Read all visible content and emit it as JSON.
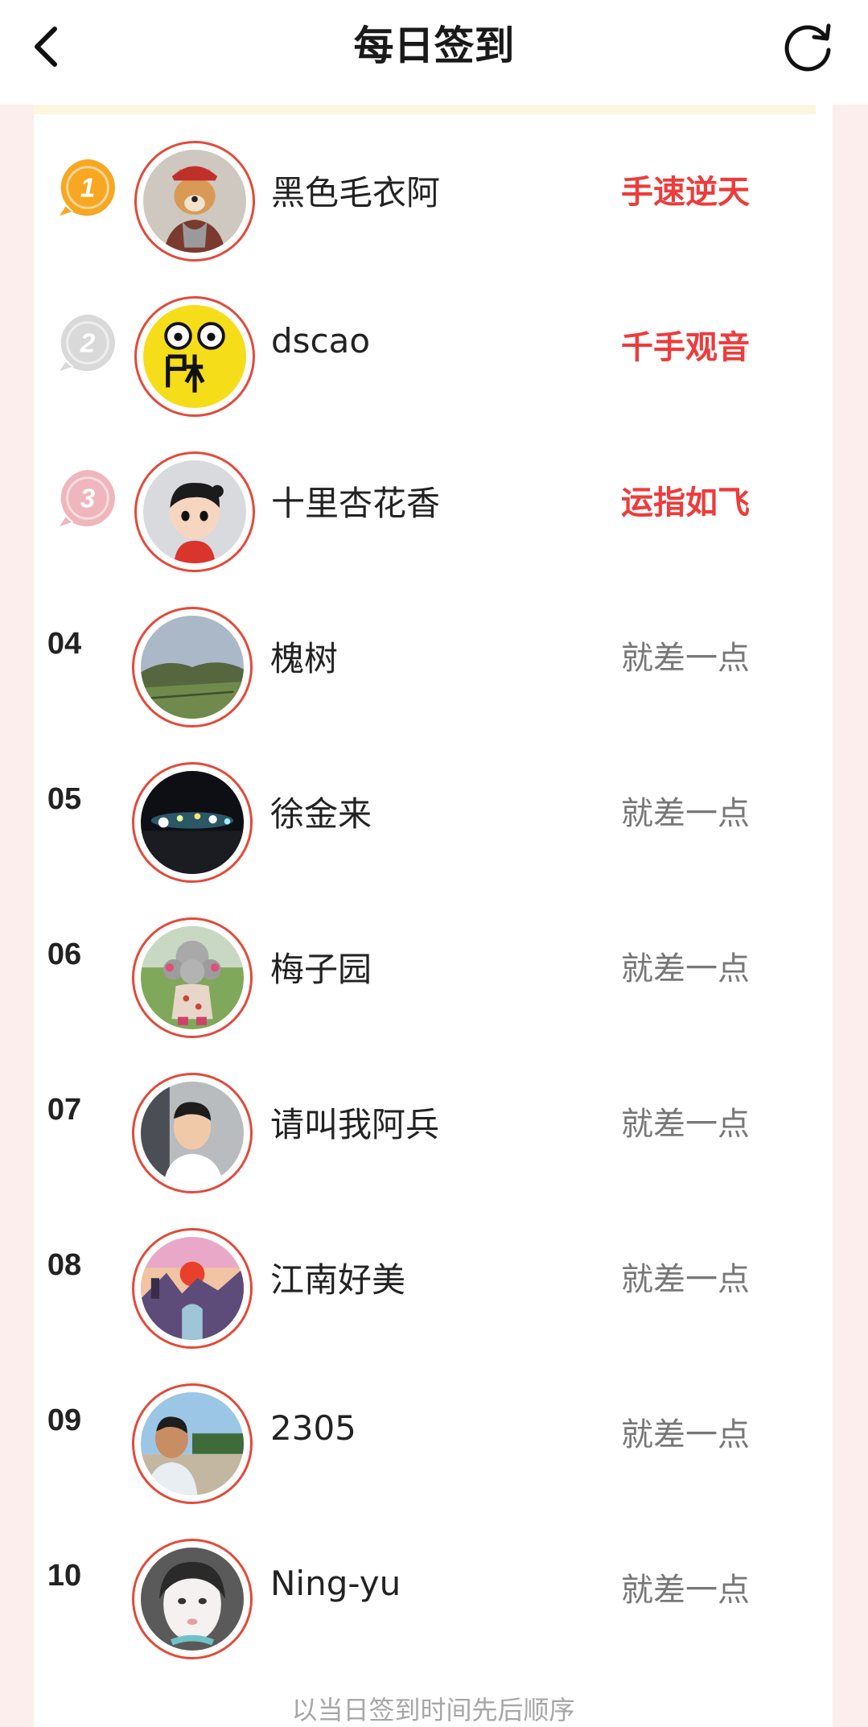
{
  "header": {
    "title": "每日签到"
  },
  "ranking": [
    {
      "rank": "1",
      "medal": "gold",
      "name": "黑色毛衣阿",
      "status": "手速逆天",
      "highlight": true,
      "avatar_icon": "shiba-dog-avatar"
    },
    {
      "rank": "2",
      "medal": "silver",
      "name": "dscao",
      "status": "千手观音",
      "highlight": true,
      "avatar_icon": "cartoon-face-avatar"
    },
    {
      "rank": "3",
      "medal": "bronze",
      "name": "十里杏花香",
      "status": "运指如飞",
      "highlight": true,
      "avatar_icon": "cartoon-kid-avatar"
    },
    {
      "rank": "04",
      "name": "槐树",
      "status": "就差一点",
      "highlight": false,
      "avatar_icon": "landscape-avatar"
    },
    {
      "rank": "05",
      "name": "徐金来",
      "status": "就差一点",
      "highlight": false,
      "avatar_icon": "night-lights-avatar"
    },
    {
      "rank": "06",
      "name": "梅子园",
      "status": "就差一点",
      "highlight": false,
      "avatar_icon": "poodle-avatar"
    },
    {
      "rank": "07",
      "name": "请叫我阿兵",
      "status": "就差一点",
      "highlight": false,
      "avatar_icon": "man-in-car-avatar"
    },
    {
      "rank": "08",
      "name": "江南好美",
      "status": "就差一点",
      "highlight": false,
      "avatar_icon": "sunset-painting-avatar"
    },
    {
      "rank": "09",
      "name": "2305",
      "status": "就差一点",
      "highlight": false,
      "avatar_icon": "man-outdoor-avatar"
    },
    {
      "rank": "10",
      "name": "Ning-yu",
      "status": "就差一点",
      "highlight": false,
      "avatar_icon": "girl-portrait-avatar"
    }
  ],
  "footer": {
    "note": "以当日签到时间先后顺序"
  },
  "colors": {
    "accent_red": "#ee3b3b",
    "gold_medal": "#f7a722",
    "silver_medal": "#d9d9d9",
    "bronze_medal": "#f0b6bd",
    "avatar_ring": "#e24a3a"
  }
}
